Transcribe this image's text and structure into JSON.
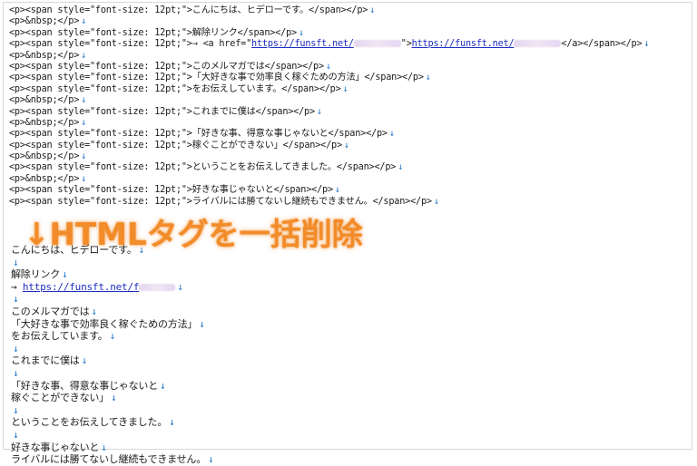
{
  "html_source": {
    "lines": [
      {
        "a": "<p><span style=\"font-size: 12pt;\">こんにちは、ヒデローです。</span></p>"
      },
      {
        "a": "<p>&nbsp;</p>"
      },
      {
        "a": "<p><span style=\"font-size: 12pt;\">解除リンク</span></p>"
      },
      {
        "a": "<p><span style=\"font-size: 12pt;\">→ <a href=\"",
        "link1": "https://funsft.net/",
        "b": "\">",
        "link2": "https://funsft.net/",
        "c": "</a></span></p>",
        "blur": true
      },
      {
        "a": "<p>&nbsp;</p>"
      },
      {
        "a": "<p><span style=\"font-size: 12pt;\">このメルマガでは</span></p>"
      },
      {
        "a": "<p><span style=\"font-size: 12pt;\">「大好きな事で効率良く稼ぐための方法」</span></p>"
      },
      {
        "a": "<p><span style=\"font-size: 12pt;\">をお伝えしています。</span></p>"
      },
      {
        "a": "<p>&nbsp;</p>"
      },
      {
        "a": "<p><span style=\"font-size: 12pt;\">これまでに僕は</span></p>"
      },
      {
        "a": "<p>&nbsp;</p>"
      },
      {
        "a": "<p><span style=\"font-size: 12pt;\">「好きな事、得意な事じゃないと</span></p>"
      },
      {
        "a": "<p><span style=\"font-size: 12pt;\">稼ぐことができない」</span></p>"
      },
      {
        "a": "<p>&nbsp;</p>"
      },
      {
        "a": "<p><span style=\"font-size: 12pt;\">ということをお伝えしてきました。</span></p>"
      },
      {
        "a": "<p>&nbsp;</p>"
      },
      {
        "a": "<p><span style=\"font-size: 12pt;\">好きな事じゃないと</span></p>"
      },
      {
        "a": "<p><span style=\"font-size: 12pt;\">ライバルには勝てないし継続もできません。</span></p>"
      }
    ]
  },
  "banner": {
    "text": "↓HTMLタグを一括削除"
  },
  "plain_text": {
    "lines": [
      {
        "a": "こんにちは、ヒデローです。"
      },
      {
        "a": ""
      },
      {
        "a": "解除リンク"
      },
      {
        "a": "→ ",
        "link": "https://funsft.net/f",
        "blur": true
      },
      {
        "a": ""
      },
      {
        "a": "このメルマガでは"
      },
      {
        "a": "「大好きな事で効率良く稼ぐための方法」"
      },
      {
        "a": "をお伝えしています。"
      },
      {
        "a": ""
      },
      {
        "a": "これまでに僕は"
      },
      {
        "a": ""
      },
      {
        "a": "「好きな事、得意な事じゃないと"
      },
      {
        "a": "稼ぐことができない」"
      },
      {
        "a": ""
      },
      {
        "a": "ということをお伝えしてきました。"
      },
      {
        "a": ""
      },
      {
        "a": "好きな事じゃないと"
      },
      {
        "a": "ライバルには勝てないし継続もできません。"
      }
    ]
  },
  "newline_marker": "↓"
}
